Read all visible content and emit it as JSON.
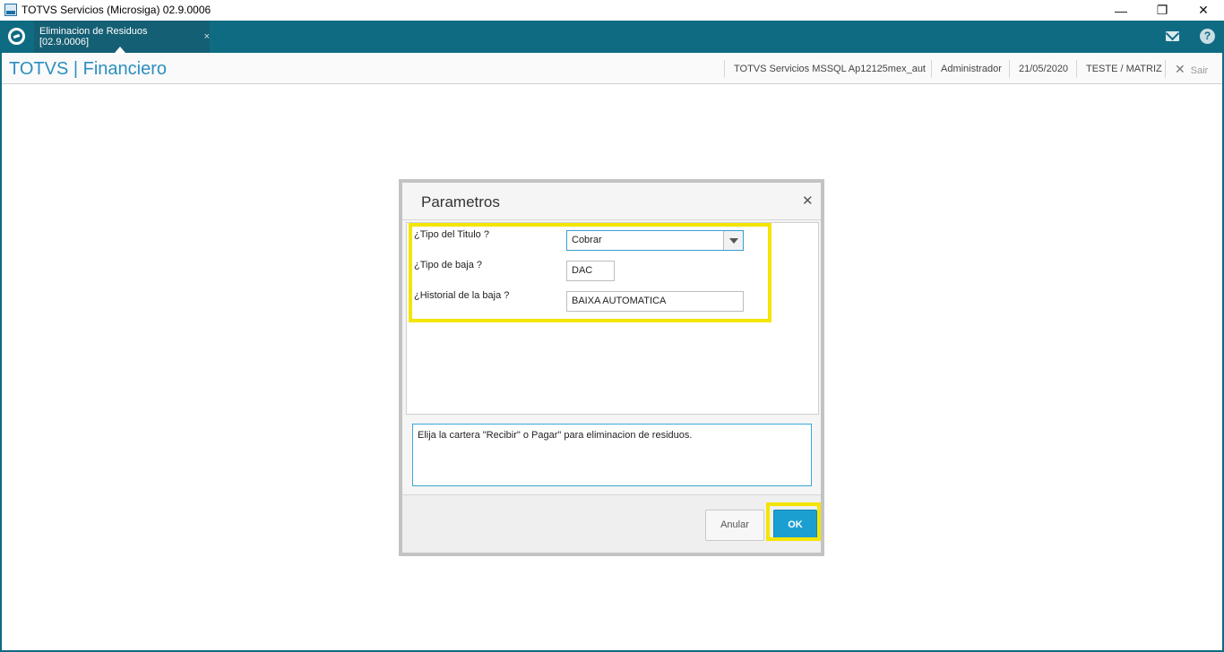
{
  "window": {
    "title": "TOTVS Servicios (Microsiga) 02.9.0006",
    "min_glyph": "—",
    "max_glyph": "❐",
    "close_glyph": "✕"
  },
  "tabbar": {
    "active_tab": "Eliminacion de Residuos [02.9.0006]",
    "tab_close_glyph": "×",
    "help_glyph": "?"
  },
  "module": {
    "title": "TOTVS | Financiero",
    "environment": "TOTVS Servicios MSSQL Ap12125mex_aut",
    "user": "Administrador",
    "date": "21/05/2020",
    "branch": "TESTE / MATRIZ",
    "exit_label": "Sair",
    "exit_glyph": "✕"
  },
  "dialog": {
    "title": "Parametros",
    "close_glyph": "✕",
    "params": [
      {
        "label": "¿Tipo del Titulo ?",
        "value": "Cobrar",
        "control": "combo"
      },
      {
        "label": "¿Tipo de baja ?",
        "value": "DAC",
        "control": "text"
      },
      {
        "label": "¿Historial de la baja ?",
        "value": "BAIXA AUTOMATICA",
        "control": "text"
      }
    ],
    "help_text": "Elija la cartera \"Recibir\" o Pagar\" para eliminacion de residuos.",
    "cancel_label": "Anular",
    "ok_label": "OK"
  },
  "colors": {
    "app_bar": "#0f6b82",
    "title_accent": "#2b8fbf",
    "highlight": "#f3e500",
    "ok_button": "#1b9fd0"
  }
}
